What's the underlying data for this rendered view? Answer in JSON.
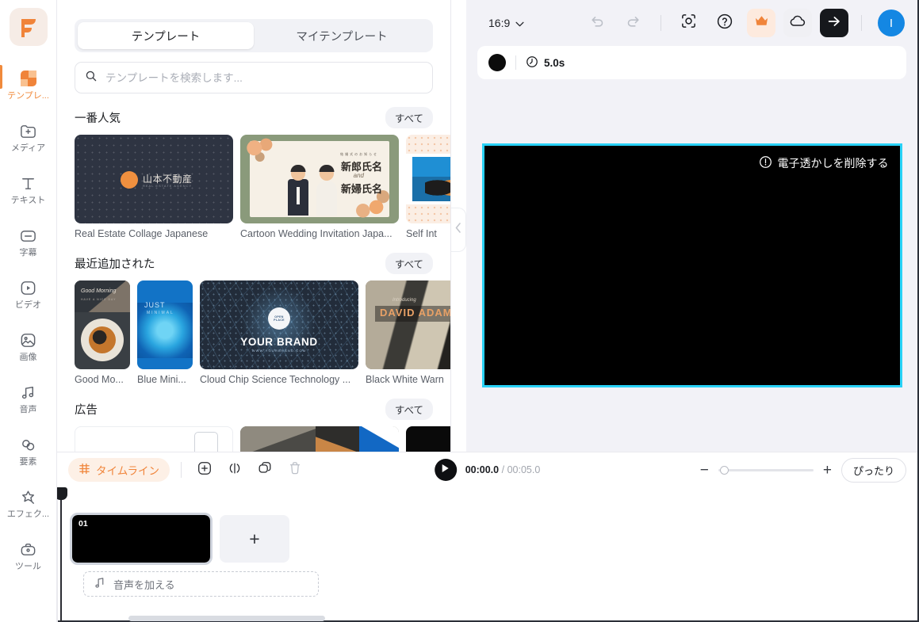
{
  "rail": {
    "logo_name": "flexclip-logo",
    "items": [
      {
        "label": "テンプレ...",
        "icon": "template-icon",
        "active": true
      },
      {
        "label": "メディア",
        "icon": "media-plus-icon",
        "active": false
      },
      {
        "label": "テキスト",
        "icon": "text-icon",
        "active": false
      },
      {
        "label": "字幕",
        "icon": "subtitle-icon",
        "active": false
      },
      {
        "label": "ビデオ",
        "icon": "video-icon",
        "active": false
      },
      {
        "label": "画像",
        "icon": "image-icon",
        "active": false
      },
      {
        "label": "音声",
        "icon": "audio-icon",
        "active": false
      },
      {
        "label": "要素",
        "icon": "element-icon",
        "active": false
      },
      {
        "label": "エフェク...",
        "icon": "effect-star-icon",
        "active": false
      },
      {
        "label": "ツール",
        "icon": "tools-briefcase-icon",
        "active": false
      }
    ]
  },
  "panel": {
    "tabs": [
      {
        "label": "テンプレート",
        "active": true
      },
      {
        "label": "マイテンプレート",
        "active": false
      }
    ],
    "search": {
      "value": "",
      "placeholder": "テンプレートを検索します..."
    },
    "sections": [
      {
        "title": "一番人気",
        "all_label": "すべて",
        "cards": [
          {
            "label": "Real Estate Collage Japanese"
          },
          {
            "label": "Cartoon Wedding Invitation Japa..."
          },
          {
            "label": "Self Int"
          }
        ]
      },
      {
        "title": "最近追加された",
        "all_label": "すべて",
        "cards": [
          {
            "label": "Good Mo..."
          },
          {
            "label": "Blue Mini..."
          },
          {
            "label": "Cloud Chip Science Technology ..."
          },
          {
            "label": "Black White Warn"
          }
        ]
      },
      {
        "title": "広告",
        "all_label": "すべて",
        "cards": []
      }
    ],
    "thumb_text": {
      "realestate_title": "山本不動産",
      "realestate_sub": "REAL ESTATE AGENCY",
      "wedding_pre": "結婚式のお知らせ",
      "wedding_name1": "新郎氏名",
      "wedding_and": "and",
      "wedding_name2": "新婦氏名",
      "coffee_title": "Good Morning",
      "coffee_sub": "HAVE A NICE DAY",
      "blue_title": "JUST",
      "blue_sub": "MINIMAL",
      "cloud_badge1": "OPEN",
      "cloud_badge2": "PLACE",
      "cloud_brand": "YOUR BRAND",
      "cloud_url": "WWW.YOURBRAND.COM",
      "bw_pre": "Introducing",
      "bw_name": "DAVID ADAMS"
    }
  },
  "collapse": {
    "icon": "chevron-left-icon"
  },
  "topbar": {
    "ratio_value": "16:9",
    "ratio_caret": "chevron-down-icon",
    "buttons": [
      {
        "name": "undo-icon"
      },
      {
        "name": "redo-icon"
      },
      {
        "name": "record-icon"
      },
      {
        "name": "help-icon"
      },
      {
        "name": "crown-upgrade-icon"
      },
      {
        "name": "cloud-save-icon"
      },
      {
        "name": "export-arrow-icon"
      }
    ],
    "avatar_initial": "I",
    "avatar_color": "#1487e3"
  },
  "duration_bar": {
    "clock_icon": "clock-icon",
    "duration": "5.0s"
  },
  "preview": {
    "watermark_label": "電子透かしを削除する",
    "watermark_icon": "exclamation-circle-icon",
    "selection_color": "#29d2f7",
    "canvas_color": "#000000"
  },
  "timeline": {
    "chip_label": "タイムライン",
    "chip_icon": "timeline-icon",
    "tools": [
      {
        "name": "add-icon"
      },
      {
        "name": "split-icon"
      },
      {
        "name": "duplicate-icon"
      },
      {
        "name": "delete-icon"
      }
    ],
    "play_icon": "play-icon",
    "current_time": "00:00.0",
    "separator": "/",
    "total_time": "00:05.0",
    "zoom_minus": "−",
    "zoom_plus": "+",
    "fit_label": "ぴったり",
    "clips": [
      {
        "number": "01"
      }
    ],
    "add_clip_label": "+",
    "audio_label": "音声を加える",
    "audio_icon": "music-note-icon"
  }
}
